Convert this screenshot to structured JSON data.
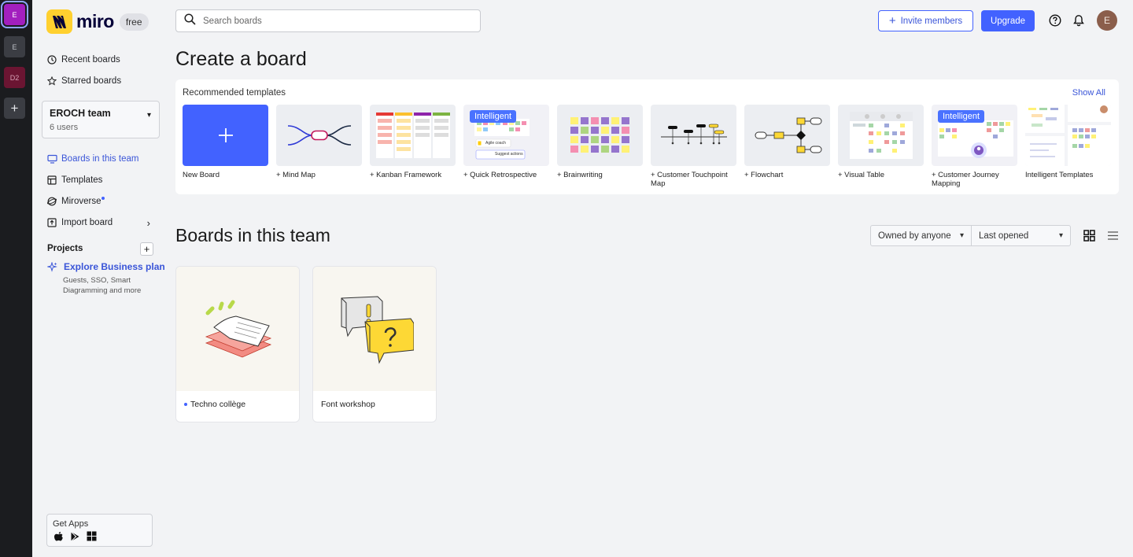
{
  "rail": {
    "teams": [
      "E",
      "E",
      "D2"
    ],
    "add_label": "+"
  },
  "brand": {
    "name": "miro",
    "plan": "free"
  },
  "search": {
    "placeholder": "Search boards"
  },
  "header": {
    "invite_label": "Invite members",
    "upgrade_label": "Upgrade",
    "avatar_initial": "E"
  },
  "sidebar": {
    "recent": "Recent boards",
    "starred": "Starred boards",
    "team": {
      "name": "EROCH team",
      "users": "6 users"
    },
    "items": [
      {
        "label": "Boards in this team",
        "icon": "boards-icon"
      },
      {
        "label": "Templates",
        "icon": "templates-icon"
      },
      {
        "label": "Miroverse",
        "icon": "miroverse-icon"
      },
      {
        "label": "Import board",
        "icon": "import-icon"
      }
    ],
    "projects_label": "Projects",
    "business": {
      "title": "Explore Business plan",
      "subtitle": "Guests, SSO, Smart Diagramming and more"
    },
    "get_apps": "Get Apps"
  },
  "create": {
    "title": "Create a board",
    "recommended": "Recommended templates",
    "show_all": "Show All",
    "templates": [
      {
        "label": "New Board"
      },
      {
        "label": "+ Mind Map"
      },
      {
        "label": "+ Kanban Framework"
      },
      {
        "label": "+ Quick Retrospective",
        "badge": "Intelligent"
      },
      {
        "label": "+ Brainwriting"
      },
      {
        "label": "+ Customer Touchpoint Map"
      },
      {
        "label": "+ Flowchart"
      },
      {
        "label": "+ Visual Table"
      },
      {
        "label": "+ Customer Journey Mapping",
        "badge": "Intelligent"
      },
      {
        "label": "Intelligent Templates"
      }
    ],
    "retro_chips": [
      "Agile coach",
      "Suggest actions"
    ]
  },
  "boards": {
    "title": "Boards in this team",
    "owner_filter": "Owned by anyone",
    "sort": "Last opened",
    "items": [
      {
        "name": "Techno collège"
      },
      {
        "name": "Font workshop"
      }
    ]
  },
  "colors": {
    "accent": "#4262ff",
    "brand_yellow": "#ffd02f"
  }
}
